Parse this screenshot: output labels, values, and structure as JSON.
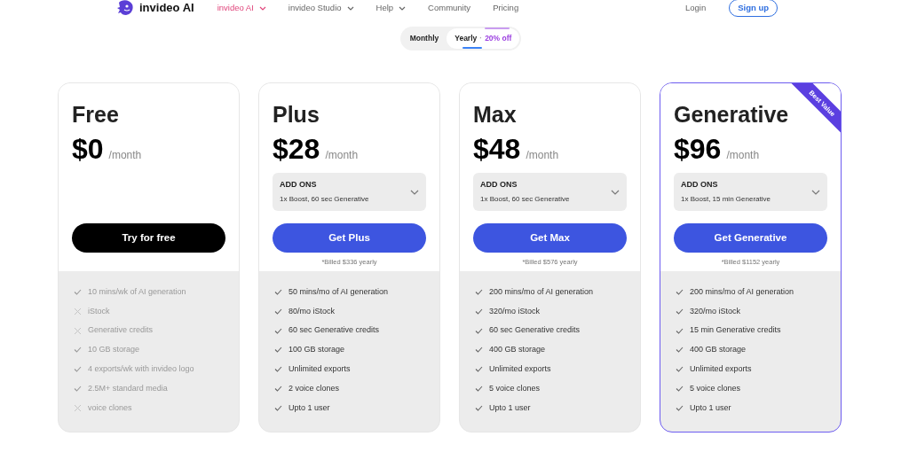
{
  "nav": {
    "brand": "invideo AI",
    "items": [
      {
        "label": "invideo AI",
        "has_menu": true,
        "selected": true
      },
      {
        "label": "invideo Studio",
        "has_menu": true,
        "selected": false
      },
      {
        "label": "Help",
        "has_menu": true,
        "selected": false
      },
      {
        "label": "Community",
        "has_menu": false,
        "selected": false
      },
      {
        "label": "Pricing",
        "has_menu": false,
        "selected": false
      }
    ],
    "login": "Login",
    "signup": "Sign up"
  },
  "billing_toggle": {
    "options": [
      {
        "label": "Monthly",
        "selected": false
      },
      {
        "label": "Yearly",
        "selected": true,
        "separator": "·",
        "discount": "20% off"
      }
    ]
  },
  "plans": [
    {
      "name": "Free",
      "price": "$0",
      "period": "/month",
      "featured": false,
      "muted": true,
      "button": {
        "label": "Try for free",
        "kind": "dark"
      },
      "features": [
        {
          "text": "10 mins/wk of AI generation",
          "included": true
        },
        {
          "text": "iStock",
          "included": false
        },
        {
          "text": "Generative credits",
          "included": false
        },
        {
          "text": "10 GB storage",
          "included": true
        },
        {
          "text": "4 exports/wk with invideo logo",
          "included": true
        },
        {
          "text": "2.5M+ standard media",
          "included": true
        },
        {
          "text": "voice clones",
          "included": false
        }
      ]
    },
    {
      "name": "Plus",
      "price": "$28",
      "period": "/month",
      "featured": false,
      "muted": false,
      "addons": {
        "title": "ADD ONS",
        "value": "1x Boost, 60 sec Generative"
      },
      "button": {
        "label": "Get Plus",
        "kind": "primary"
      },
      "billed": "*Billed $336 yearly",
      "features": [
        {
          "text": "50 mins/mo of AI generation",
          "included": true
        },
        {
          "text": "80/mo iStock",
          "included": true
        },
        {
          "text": "60 sec Generative credits",
          "included": true
        },
        {
          "text": "100 GB storage",
          "included": true
        },
        {
          "text": "Unlimited exports",
          "included": true
        },
        {
          "text": "2 voice clones",
          "included": true
        },
        {
          "text": "Upto 1 user",
          "included": true
        }
      ]
    },
    {
      "name": "Max",
      "price": "$48",
      "period": "/month",
      "featured": false,
      "muted": false,
      "addons": {
        "title": "ADD ONS",
        "value": "1x Boost, 60 sec Generative"
      },
      "button": {
        "label": "Get Max",
        "kind": "primary"
      },
      "billed": "*Billed $576 yearly",
      "features": [
        {
          "text": "200 mins/mo of AI generation",
          "included": true
        },
        {
          "text": "320/mo iStock",
          "included": true
        },
        {
          "text": "60 sec Generative credits",
          "included": true
        },
        {
          "text": "400 GB storage",
          "included": true
        },
        {
          "text": "Unlimited exports",
          "included": true
        },
        {
          "text": "5 voice clones",
          "included": true
        },
        {
          "text": "Upto 1 user",
          "included": true
        }
      ]
    },
    {
      "name": "Generative",
      "price": "$96",
      "period": "/month",
      "featured": true,
      "badge": "Best Value",
      "muted": false,
      "addons": {
        "title": "ADD ONS",
        "value": "1x Boost, 15 min Generative"
      },
      "button": {
        "label": "Get Generative",
        "kind": "primary"
      },
      "billed": "*Billed $1152 yearly",
      "features": [
        {
          "text": "200 mins/mo of AI generation",
          "included": true
        },
        {
          "text": "320/mo iStock",
          "included": true
        },
        {
          "text": "15 min Generative credits",
          "included": true
        },
        {
          "text": "400 GB storage",
          "included": true
        },
        {
          "text": "Unlimited exports",
          "included": true
        },
        {
          "text": "5 voice clones",
          "included": true
        },
        {
          "text": "Upto 1 user",
          "included": true
        }
      ]
    }
  ]
}
